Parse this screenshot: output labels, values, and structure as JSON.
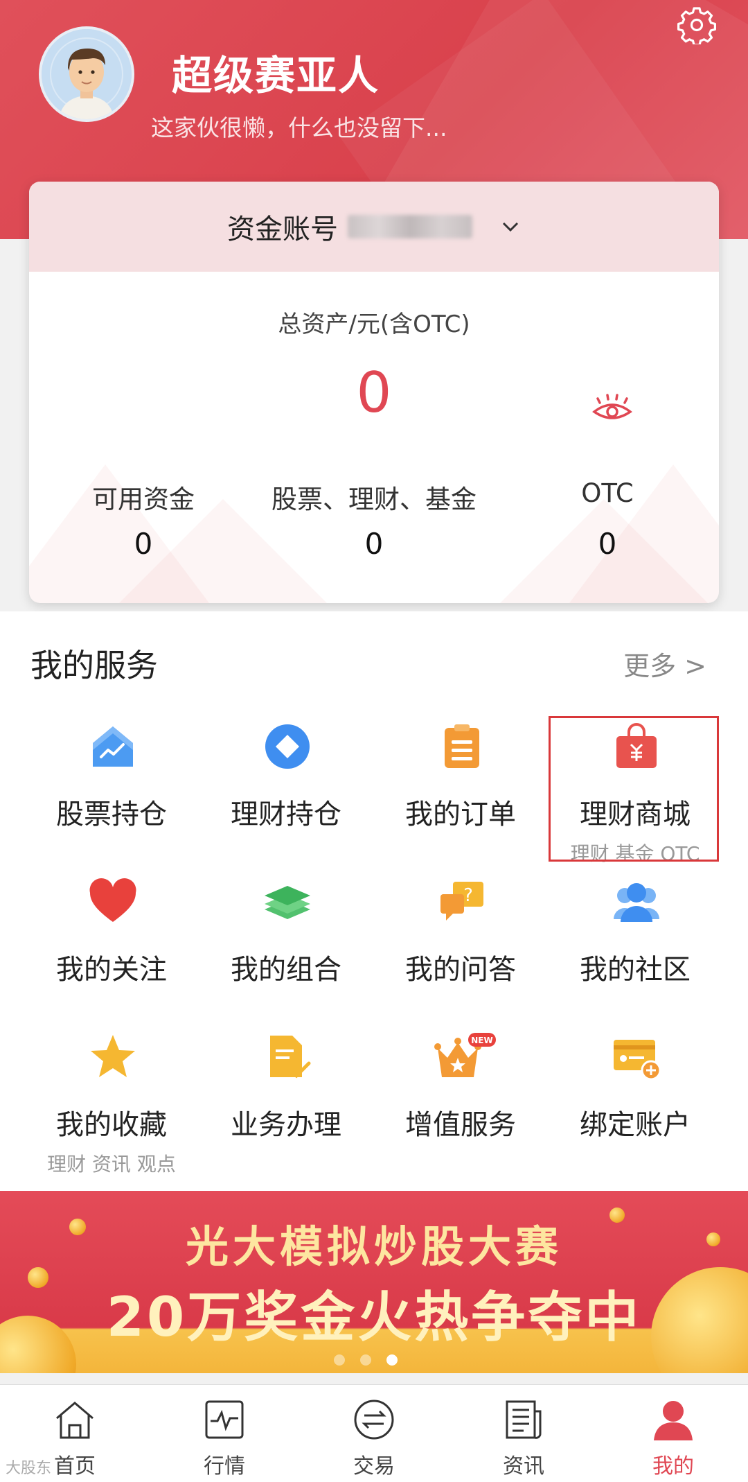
{
  "profile": {
    "name": "超级赛亚人",
    "bio": "这家伙很懒，什么也没留下..."
  },
  "account": {
    "label": "资金账号"
  },
  "assets": {
    "total_label": "总资产/元(含OTC)",
    "total_value": "0",
    "stats": [
      {
        "label": "可用资金",
        "value": "0"
      },
      {
        "label": "股票、理财、基金",
        "value": "0"
      },
      {
        "label": "OTC",
        "value": "0"
      }
    ]
  },
  "services": {
    "title": "我的服务",
    "more": "更多 >",
    "items": [
      {
        "label": "股票持仓",
        "icon": "stock-house-icon"
      },
      {
        "label": "理财持仓",
        "icon": "diamond-icon"
      },
      {
        "label": "我的订单",
        "icon": "clipboard-icon"
      },
      {
        "label": "理财商城",
        "sub": "理财 基金 OTC",
        "icon": "shopping-bag-icon"
      },
      {
        "label": "我的关注",
        "icon": "heart-icon"
      },
      {
        "label": "我的组合",
        "icon": "layers-icon"
      },
      {
        "label": "我的问答",
        "icon": "question-chat-icon"
      },
      {
        "label": "我的社区",
        "icon": "people-icon"
      },
      {
        "label": "我的收藏",
        "sub": "理财 资讯 观点",
        "icon": "star-icon"
      },
      {
        "label": "业务办理",
        "icon": "document-check-icon"
      },
      {
        "label": "增值服务",
        "icon": "crown-new-icon"
      },
      {
        "label": "绑定账户",
        "icon": "card-add-icon"
      }
    ],
    "new_badge": "NEW"
  },
  "banner": {
    "line1": "光大模拟炒股大赛",
    "line2": "20万奖金火热争夺中"
  },
  "tabs": [
    {
      "label": "首页",
      "icon": "home-icon"
    },
    {
      "label": "行情",
      "icon": "pulse-icon"
    },
    {
      "label": "交易",
      "icon": "exchange-icon"
    },
    {
      "label": "资讯",
      "icon": "news-icon"
    },
    {
      "label": "我的",
      "icon": "user-icon"
    }
  ],
  "watermark": "大股东",
  "colors": {
    "brand": "#e04753",
    "header": "#dc4450",
    "blue": "#3f8ef0",
    "orange": "#f39a35",
    "gold": "#f5b731"
  }
}
